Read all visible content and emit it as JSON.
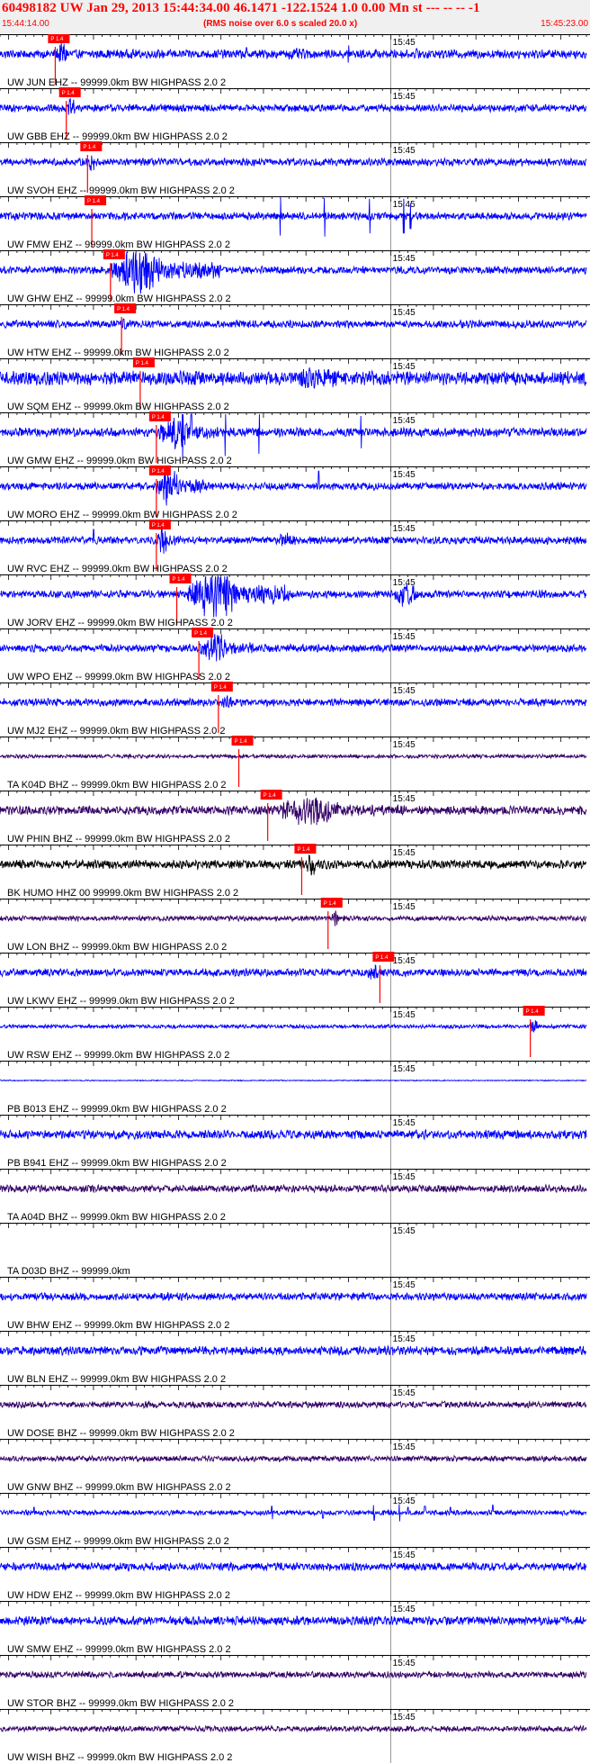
{
  "header": {
    "title": "60498182 UW Jan 29, 2013 15:44:34.00   46.1471 -122.1524  1.0 0.00 Mn st --- -- --  -1",
    "start_time": "15:44:14.00",
    "note": "(RMS noise over 6.0 s scaled 20.0 x)",
    "end_time": "15:45:23.00"
  },
  "chart_data": {
    "type": "line",
    "title": "60498182 UW Jan 29, 2013 15:44:34.00   46.1471 -122.1524  1.0 0.00 Mn st --- -- --  -1",
    "x_start": "15:44:14.00",
    "x_end": "15:45:23.00",
    "x_tick_label": "15:45",
    "pick_label": "P 1.4",
    "colors": {
      "blue": "#0000ff",
      "navy": "#330066",
      "black": "#000000",
      "pick": "#ff0000",
      "header": "#ff0000"
    },
    "traces": [
      {
        "label": "UW JUN EHZ -- 99999.0km BW  HIGHPASS  2.0  2",
        "pick": "15:44:20.5",
        "color": "blue",
        "amp": 0.35,
        "bursts": [
          [
            20.5,
            23.5,
            1.0
          ],
          [
            46,
            56,
            0.45
          ]
        ],
        "spikes": [
          [
            43,
            0.6
          ],
          [
            55,
            0.8
          ],
          [
            63,
            0.5
          ]
        ]
      },
      {
        "label": "UW GBB EHZ -- 99999.0km BW  HIGHPASS  2.0  2",
        "pick": "15:44:21.8",
        "color": "blue",
        "amp": 0.3,
        "bursts": [
          [
            21.8,
            24,
            0.8
          ]
        ],
        "spikes": []
      },
      {
        "label": "UW SVOH EHZ -- 99999.0km BW  HIGHPASS  2.0  2",
        "pick": "15:44:24.3",
        "color": "blue",
        "amp": 0.3,
        "bursts": [
          [
            24.3,
            26,
            0.9
          ]
        ],
        "spikes": []
      },
      {
        "label": "UW FMW EHZ -- 99999.0km BW  HIGHPASS  2.0  2",
        "pick": "15:44:24.8",
        "color": "blue",
        "amp": 0.3,
        "bursts": [],
        "spikes": [
          [
            47,
            1.8
          ],
          [
            52.2,
            1.9
          ],
          [
            57.5,
            1.6
          ],
          [
            61.5,
            1.6
          ],
          [
            62.3,
            1.2
          ]
        ]
      },
      {
        "label": "UW GHW EHZ -- 99999.0km BW  HIGHPASS  2.0  2",
        "pick": "15:44:27.0",
        "color": "blue",
        "amp": 0.3,
        "bursts": [
          [
            27,
            40,
            2.0
          ]
        ],
        "spikes": []
      },
      {
        "label": "UW HTW EHZ -- 99999.0km BW  HIGHPASS  2.0  2",
        "pick": "15:44:28.3",
        "color": "blue",
        "amp": 0.3,
        "bursts": [
          [
            28.3,
            30,
            0.6
          ]
        ],
        "spikes": []
      },
      {
        "label": "UW SQM EHZ -- 99999.0km BW  HIGHPASS  2.0  2",
        "pick": "15:44:30.5",
        "color": "blue",
        "amp": 0.55,
        "bursts": [
          [
            45,
            65,
            0.9
          ]
        ],
        "spikes": []
      },
      {
        "label": "UW GMW EHZ -- 99999.0km BW  HIGHPASS  2.0  2",
        "pick": "15:44:32.4",
        "color": "blue",
        "amp": 0.35,
        "bursts": [
          [
            32.4,
            40,
            1.5
          ]
        ],
        "spikes": [
          [
            35.5,
            2.5
          ],
          [
            36.5,
            2.4
          ],
          [
            40.5,
            2.2
          ],
          [
            44.5,
            2.0
          ],
          [
            56.5,
            1.5
          ]
        ]
      },
      {
        "label": "UW MORO EHZ -- 99999.0km BW  HIGHPASS  2.0  2",
        "pick": "15:44:32.4",
        "color": "blue",
        "amp": 0.3,
        "bursts": [
          [
            32.4,
            38,
            1.6
          ]
        ],
        "spikes": [
          [
            51.5,
            1.4
          ]
        ]
      },
      {
        "label": "UW RVC EHZ -- 99999.0km BW  HIGHPASS  2.0  2",
        "pick": "15:44:32.4",
        "color": "blue",
        "amp": 0.3,
        "bursts": [
          [
            32.4,
            35,
            1.3
          ],
          [
            46,
            52,
            0.6
          ]
        ],
        "spikes": [
          [
            25,
            1.0
          ]
        ]
      },
      {
        "label": "UW JORV EHZ -- 99999.0km BW  HIGHPASS  2.0  2",
        "pick": "15:44:34.8",
        "color": "blue",
        "amp": 0.3,
        "bursts": [
          [
            36,
            48,
            2.2
          ],
          [
            60,
            66,
            1.0
          ]
        ],
        "spikes": []
      },
      {
        "label": "UW WPO EHZ -- 99999.0km BW  HIGHPASS  2.0  2",
        "pick": "15:44:37.4",
        "color": "blue",
        "amp": 0.3,
        "bursts": [
          [
            37.4,
            44,
            1.4
          ]
        ],
        "spikes": []
      },
      {
        "label": "UW MJ2 EHZ -- 99999.0km BW  HIGHPASS  2.0  2",
        "pick": "15:44:39.7",
        "color": "blue",
        "amp": 0.3,
        "bursts": [
          [
            39.7,
            43,
            0.6
          ]
        ],
        "spikes": []
      },
      {
        "label": "TA K04D BHZ -- 99999.0km BW  HIGHPASS  2.0  2",
        "pick": "15:44:42.1",
        "color": "navy",
        "amp": 0.15,
        "bursts": [],
        "spikes": []
      },
      {
        "label": "UW PHIN BHZ -- 99999.0km BW  HIGHPASS  2.0  2",
        "pick": "15:44:45.5",
        "color": "navy",
        "amp": 0.35,
        "bursts": [
          [
            46,
            62,
            1.3
          ]
        ],
        "spikes": []
      },
      {
        "label": "BK HUMO HHZ 00 99999.0km BW  HIGHPASS  2.0  2",
        "pick": "15:44:49.5",
        "color": "black",
        "amp": 0.35,
        "bursts": [
          [
            50,
            52,
            1.8
          ]
        ],
        "spikes": []
      },
      {
        "label": "UW LON BHZ -- 99999.0km BW  HIGHPASS  2.0  2",
        "pick": "15:44:52.6",
        "color": "navy",
        "amp": 0.2,
        "bursts": [
          [
            53,
            54.5,
            0.9
          ]
        ],
        "spikes": []
      },
      {
        "label": "UW LKWV EHZ -- 99999.0km BW  HIGHPASS  2.0  2",
        "pick": "15:44:58.7",
        "color": "blue",
        "amp": 0.3,
        "bursts": [
          [
            57,
            60,
            0.8
          ]
        ],
        "spikes": []
      },
      {
        "label": "UW RSW EHZ -- 99999.0km BW  HIGHPASS  2.0  2",
        "pick": "15:45:16.4",
        "color": "blue",
        "amp": 0.15,
        "bursts": [
          [
            16.4,
            17.2,
            1.8
          ]
        ],
        "spikes": []
      },
      {
        "label": "PB B013 EHZ -- 99999.0km BW  HIGHPASS  2.0  2",
        "pick": null,
        "color": "blue",
        "amp": 0.04,
        "bursts": [],
        "spikes": []
      },
      {
        "label": "PB B941 EHZ -- 99999.0km BW  HIGHPASS  2.0  2",
        "pick": null,
        "color": "blue",
        "amp": 0.35,
        "bursts": [],
        "spikes": []
      },
      {
        "label": "TA A04D BHZ -- 99999.0km BW  HIGHPASS  2.0  2",
        "pick": null,
        "color": "navy",
        "amp": 0.28,
        "bursts": [],
        "spikes": []
      },
      {
        "label": "TA D03D BHZ -- 99999.0km",
        "pick": null,
        "color": "none",
        "amp": 0,
        "bursts": [],
        "spikes": []
      },
      {
        "label": "UW BHW EHZ -- 99999.0km BW  HIGHPASS  2.0  2",
        "pick": null,
        "color": "blue",
        "amp": 0.3,
        "bursts": [],
        "spikes": []
      },
      {
        "label": "UW BLN EHZ -- 99999.0km BW  HIGHPASS  2.0  2",
        "pick": null,
        "color": "blue",
        "amp": 0.35,
        "bursts": [],
        "spikes": []
      },
      {
        "label": "UW DOSE BHZ -- 99999.0km BW  HIGHPASS  2.0  2",
        "pick": null,
        "color": "navy",
        "amp": 0.25,
        "bursts": [],
        "spikes": []
      },
      {
        "label": "UW GNW BHZ -- 99999.0km BW  HIGHPASS  2.0  2",
        "pick": null,
        "color": "navy",
        "amp": 0.22,
        "bursts": [],
        "spikes": []
      },
      {
        "label": "UW GSM EHZ -- 99999.0km BW  HIGHPASS  2.0  2",
        "pick": null,
        "color": "blue",
        "amp": 0.2,
        "bursts": [],
        "spikes": [
          [
            1,
            0.8
          ],
          [
            4,
            0.6
          ],
          [
            7,
            0.5
          ],
          [
            12,
            0.7
          ],
          [
            18,
            0.5
          ],
          [
            46,
            0.6
          ],
          [
            52,
            0.5
          ],
          [
            58,
            0.7
          ],
          [
            62,
            0.5
          ]
        ]
      },
      {
        "label": "UW HDW EHZ -- 99999.0km BW  HIGHPASS  2.0  2",
        "pick": null,
        "color": "blue",
        "amp": 0.32,
        "bursts": [],
        "spikes": []
      },
      {
        "label": "UW SMW EHZ -- 99999.0km BW  HIGHPASS  2.0  2",
        "pick": null,
        "color": "blue",
        "amp": 0.35,
        "bursts": [],
        "spikes": []
      },
      {
        "label": "UW STOR BHZ -- 99999.0km BW  HIGHPASS  2.0  2",
        "pick": null,
        "color": "navy",
        "amp": 0.25,
        "bursts": [],
        "spikes": []
      },
      {
        "label": "UW WISH BHZ -- 99999.0km BW  HIGHPASS  2.0  2",
        "pick": null,
        "color": "navy",
        "amp": 0.22,
        "bursts": [],
        "spikes": []
      }
    ]
  }
}
